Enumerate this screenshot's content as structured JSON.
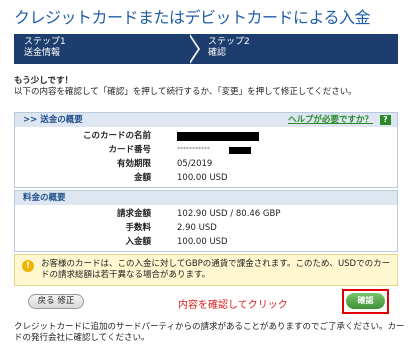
{
  "page": {
    "title": "クレジットカードまたはデビットカードによる入金"
  },
  "steps": [
    {
      "title": "ステップ1",
      "subtitle": "送金情報"
    },
    {
      "title": "ステップ2",
      "subtitle": "確認"
    }
  ],
  "intro": {
    "heading": "もう少しです！",
    "text": "以下の内容を確認して「確認」を押して続行するか、「変更」を押して修正してください。"
  },
  "transfer_panel": {
    "header": ">> 送金の概要",
    "help_link": "ヘルプが必要ですか？",
    "help_icon": "?",
    "rows": [
      {
        "label": "このカードの名前",
        "value": ""
      },
      {
        "label": "カード番号",
        "value": "***********"
      },
      {
        "label": "有効期限",
        "value": "05/2019"
      },
      {
        "label": "金額",
        "value": "100.00 USD"
      }
    ]
  },
  "fee_panel": {
    "header": "料金の概要",
    "rows": [
      {
        "label": "請求金額",
        "value": "102.90 USD / 80.46 GBP"
      },
      {
        "label": "手数料",
        "value": "2.90 USD"
      },
      {
        "label": "入金額",
        "value": "100.00 USD"
      }
    ]
  },
  "notice": {
    "icon": "!",
    "text": "お客様のカードは、この入金に対してGBPの通貨で課金されます。このため、USDでのカードの請求総額は若干異なる場合があります。"
  },
  "buttons": {
    "back_edit": "戻る 修正",
    "confirm": "確認"
  },
  "annotation": "内容を確認してクリック",
  "footer": "クレジットカードに追加のサードパーティからの請求があることがありますのでご了承ください。カードの発行会社に確認してください。"
}
